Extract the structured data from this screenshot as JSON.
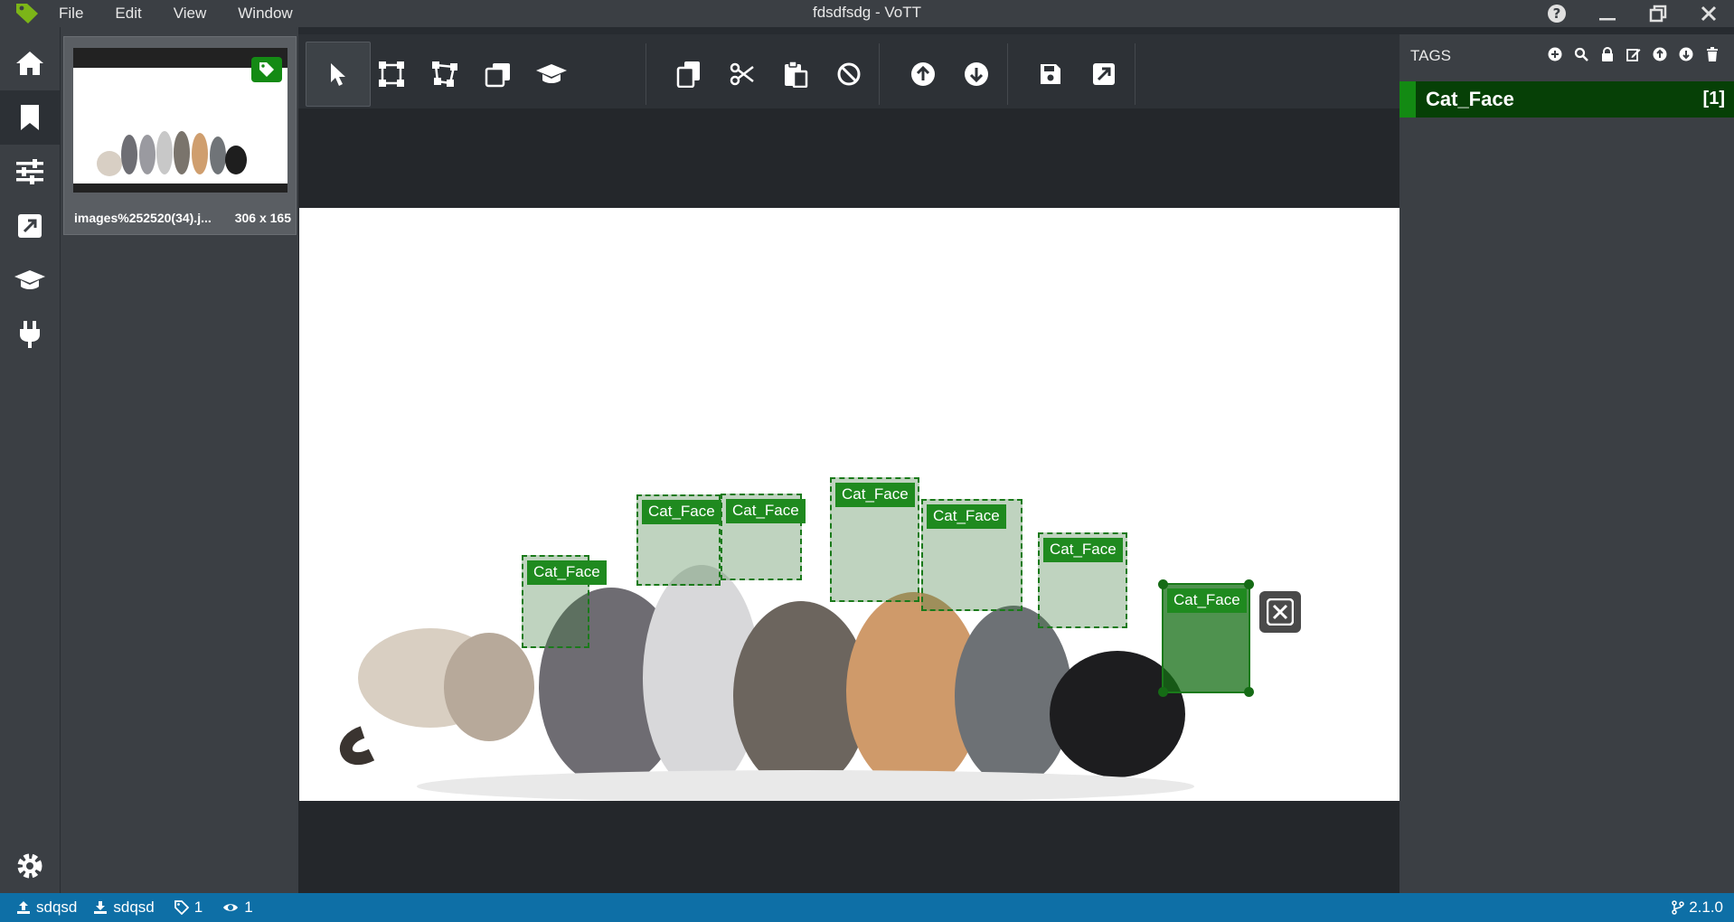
{
  "app": {
    "window_title": "fdsdfsdg - VoTT",
    "menu": [
      "File",
      "Edit",
      "View",
      "Window"
    ]
  },
  "sidebar": {
    "items": [
      {
        "icon": "home-icon",
        "label": "Home"
      },
      {
        "icon": "bookmark-icon",
        "label": "Editor",
        "active": true
      },
      {
        "icon": "sliders-icon",
        "label": "Settings"
      },
      {
        "icon": "export-icon",
        "label": "Export"
      },
      {
        "icon": "graduation-cap-icon",
        "label": "Active learning"
      },
      {
        "icon": "plug-icon",
        "label": "Connections"
      }
    ],
    "bottom_icon": "gear-icon"
  },
  "thumbnails": [
    {
      "filename": "images%252520(34).j...",
      "dimensions": "306 x 165",
      "tagged": true
    }
  ],
  "toolbar": {
    "groups": [
      [
        "pointer-icon",
        "rectangle-icon",
        "polygon-icon",
        "copy-rectangle-icon",
        "active-learning-icon"
      ],
      [
        "copy-icon",
        "cut-icon",
        "paste-icon",
        "clear-icon"
      ],
      [
        "previous-asset-icon",
        "next-asset-icon"
      ],
      [
        "save-icon",
        "export-icon"
      ]
    ],
    "selected": "pointer-icon"
  },
  "regions": [
    {
      "tag": "Cat_Face",
      "selected": false
    },
    {
      "tag": "Cat_Face",
      "selected": false
    },
    {
      "tag": "Cat_Face",
      "selected": false
    },
    {
      "tag": "Cat_Face",
      "selected": false
    },
    {
      "tag": "Cat_Face",
      "selected": false
    },
    {
      "tag": "Cat_Face",
      "selected": false
    },
    {
      "tag": "Cat_Face",
      "selected": true
    }
  ],
  "tags_panel": {
    "title": "TAGS",
    "tools": [
      "add-icon",
      "search-icon",
      "lock-icon",
      "edit-icon",
      "move-up-icon",
      "move-down-icon",
      "delete-icon"
    ],
    "tags": [
      {
        "name": "Cat_Face",
        "shortcut": "[1]",
        "color": "#138a13"
      }
    ]
  },
  "statusbar": {
    "source": "sdqsd",
    "target": "sdqsd",
    "tag_count": "1",
    "visited_count": "1",
    "version": "2.1.0"
  },
  "colors": {
    "accent": "#138a13",
    "statusbar": "#0e6fa6"
  }
}
